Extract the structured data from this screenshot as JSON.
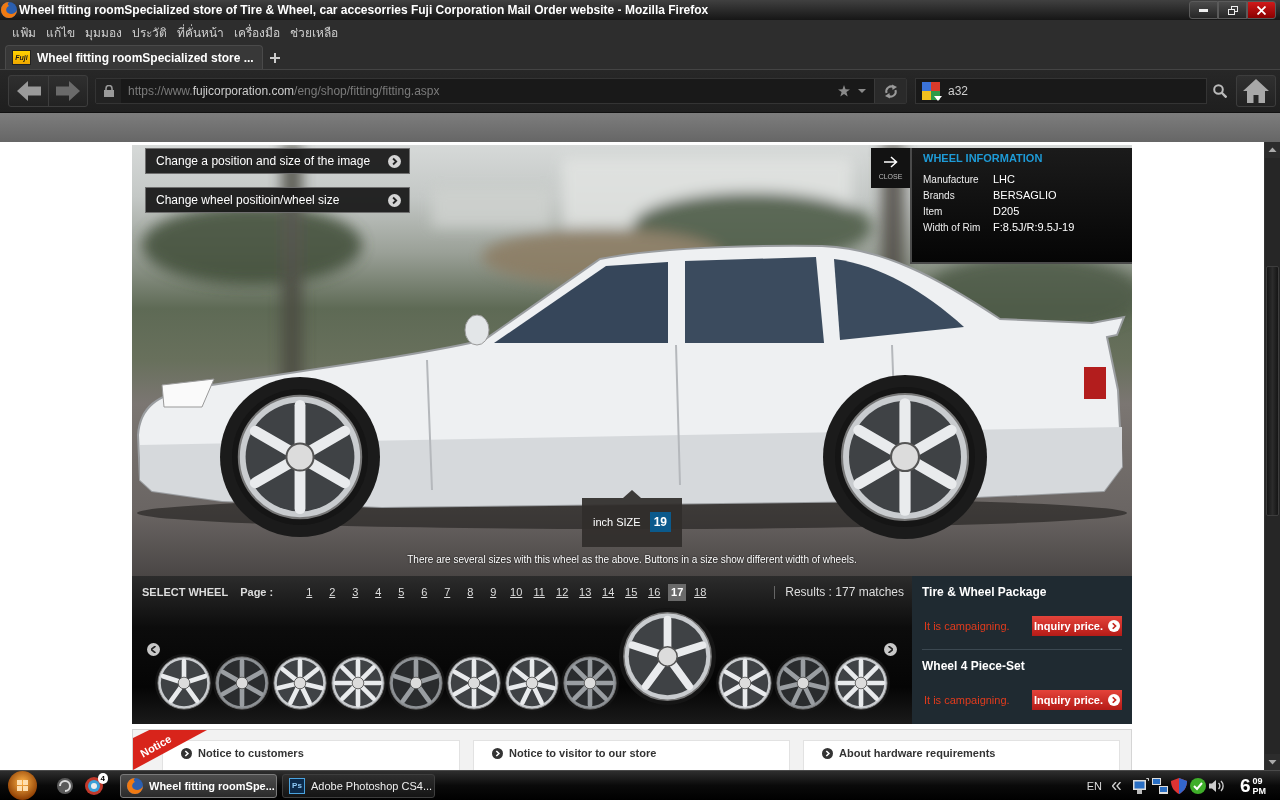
{
  "window": {
    "title": "Wheel fitting roomSpecialized store of Tire & Wheel, car accesorries Fuji Corporation Mail Order website - Mozilla Firefox"
  },
  "menu": [
    "แฟ้ม",
    "แก้ไข",
    "มุมมอง",
    "ประวัติ",
    "ที่คั่นหน้า",
    "เครื่องมือ",
    "ช่วยเหลือ"
  ],
  "tabs": [
    {
      "label": "Wheel fitting roomSpecialized store ...",
      "favicon_text": "Fuji",
      "selected": true
    }
  ],
  "address_bar": {
    "url_start": "https://www.",
    "url_domain": "fujicorporation.com",
    "url_end": "/eng/shop/fitting/fitting.aspx"
  },
  "search_bar": {
    "value": "a32"
  },
  "page": {
    "image_buttons": [
      "Change a position and size of the image",
      "Change wheel positioin/wheel size"
    ],
    "wheel_info": {
      "close": "CLOSE",
      "title": "WHEEL INFORMATION",
      "rows": [
        {
          "label": "Manufacture",
          "value": "LHC"
        },
        {
          "label": "Brands",
          "value": "BERSAGLIO"
        },
        {
          "label": "Item",
          "value": "D205"
        },
        {
          "label": "Width of Rim",
          "value": "F:8.5J/R:9.5J-19"
        }
      ]
    },
    "size_tooltip": {
      "label": "inch SIZE",
      "sizes": [
        {
          "label": "19",
          "selected": true
        }
      ]
    },
    "caption": "There are several sizes with this wheel as the above. Buttons in a size show different width of wheels.",
    "select_wheel": {
      "title": "SELECT WHEEL",
      "page_label": "Page :",
      "pages": [
        {
          "label": "1",
          "selected": false
        },
        {
          "label": "2",
          "selected": false
        },
        {
          "label": "3",
          "selected": false
        },
        {
          "label": "4",
          "selected": false
        },
        {
          "label": "5",
          "selected": false
        },
        {
          "label": "6",
          "selected": false
        },
        {
          "label": "7",
          "selected": false
        },
        {
          "label": "8",
          "selected": false
        },
        {
          "label": "9",
          "selected": false
        },
        {
          "label": "10",
          "selected": false
        },
        {
          "label": "11",
          "selected": false
        },
        {
          "label": "12",
          "selected": false
        },
        {
          "label": "13",
          "selected": false
        },
        {
          "label": "14",
          "selected": false
        },
        {
          "label": "15",
          "selected": false
        },
        {
          "label": "16",
          "selected": false
        },
        {
          "label": "17",
          "selected": true
        },
        {
          "label": "18",
          "selected": false
        }
      ],
      "results": "Results : 177 matches",
      "thumbnails": [
        {
          "selected": false
        },
        {
          "selected": false
        },
        {
          "selected": false
        },
        {
          "selected": false
        },
        {
          "selected": false
        },
        {
          "selected": false
        },
        {
          "selected": false
        },
        {
          "selected": false
        },
        {
          "selected": true
        },
        {
          "selected": false
        },
        {
          "selected": false
        },
        {
          "selected": false
        }
      ]
    },
    "packages": [
      {
        "title": "Tire & Wheel Package",
        "status": "It is campaigning.",
        "button": "Inquiry price."
      },
      {
        "title": "Wheel 4 Piece-Set",
        "status": "It is campaigning.",
        "button": "Inquiry price."
      }
    ],
    "notice": {
      "ribbon": "Notice",
      "items": [
        "Notice to customers",
        "Notice to visitor to our store",
        "About hardware requirements"
      ]
    }
  },
  "taskbar": {
    "badge": "4",
    "tasks": [
      {
        "kind": "browser",
        "label": "Wheel fitting roomSpe...",
        "selected": true
      },
      {
        "kind": "lettered",
        "icon_text": "Ps",
        "label": "Adobe Photoshop CS4...",
        "selected": false
      }
    ],
    "language": "EN",
    "clock": {
      "hour": "6",
      "minute": "09",
      "period": "PM"
    }
  }
}
